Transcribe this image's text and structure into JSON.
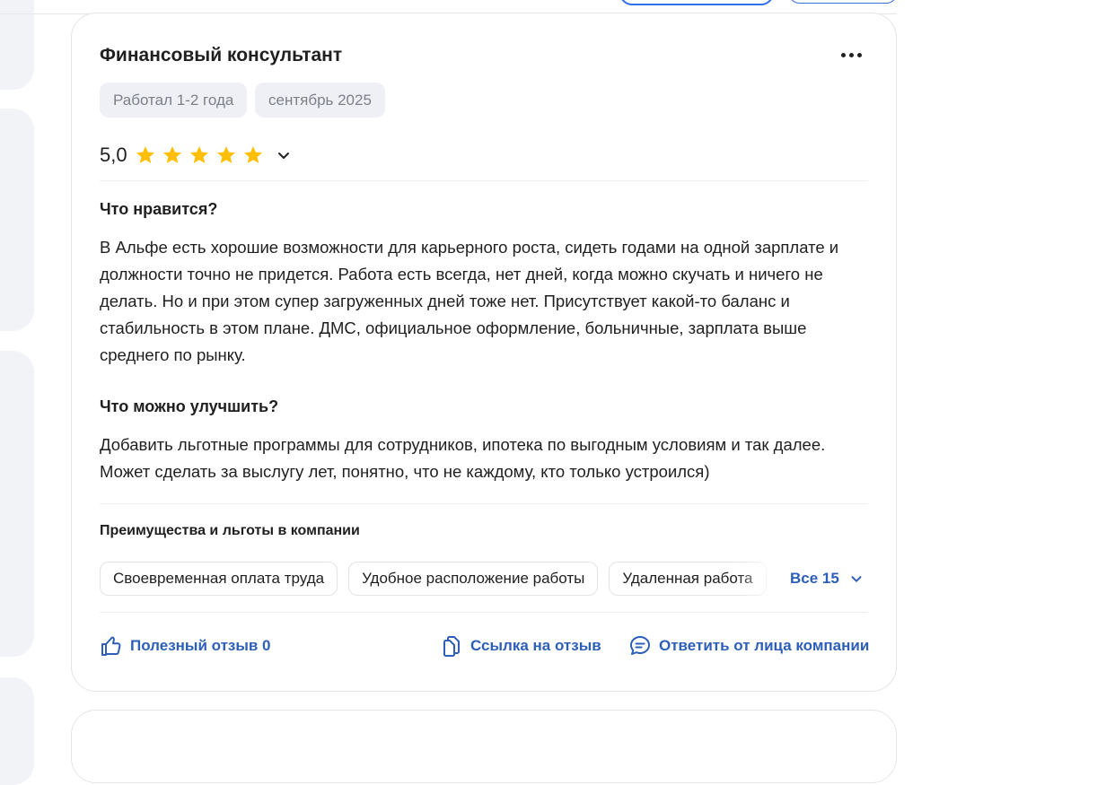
{
  "review": {
    "title": "Финансовый консультант",
    "tags": [
      "Работал 1-2 года",
      "сентябрь 2025"
    ],
    "rating": "5,0",
    "stars": 5,
    "pros_heading": "Что нравится?",
    "pros_text": "В Альфе есть хорошие возможности для карьерного роста, сидеть годами на одной зарплате и должности точно не придется. Работа есть всегда, нет дней, когда можно скучать и ничего не делать. Но и при этом супер загруженных дней тоже нет. Присутствует какой-то баланс и стабильность в этом плане. ДМС, официальное оформление, больничные, зарплата выше среднего по рынку.",
    "cons_heading": "Что можно улучшить?",
    "cons_text": "Добавить льготные программы для сотрудников, ипотека по выгодным условиям и так далее. Может сделать за выслугу лет, понятно, что не каждому, кто только устроился)",
    "benefits_heading": "Преимущества и льготы в компании",
    "benefits": [
      "Своевременная оплата труда",
      "Удобное расположение работы",
      "Удаленная работа"
    ],
    "all_benefits_label": "Все 15",
    "actions": {
      "helpful": "Полезный отзыв 0",
      "link": "Ссылка на отзыв",
      "reply": "Ответить от лица компании"
    }
  },
  "colors": {
    "star": "#ffbf00",
    "link": "#2d5fb9",
    "chip_bg": "#eef0f5",
    "chip_text": "#7c8089"
  },
  "icons": [
    "more-icon",
    "star-icon",
    "chevron-down-icon",
    "thumbs-up-icon",
    "copy-link-icon",
    "chat-bubble-icon"
  ]
}
